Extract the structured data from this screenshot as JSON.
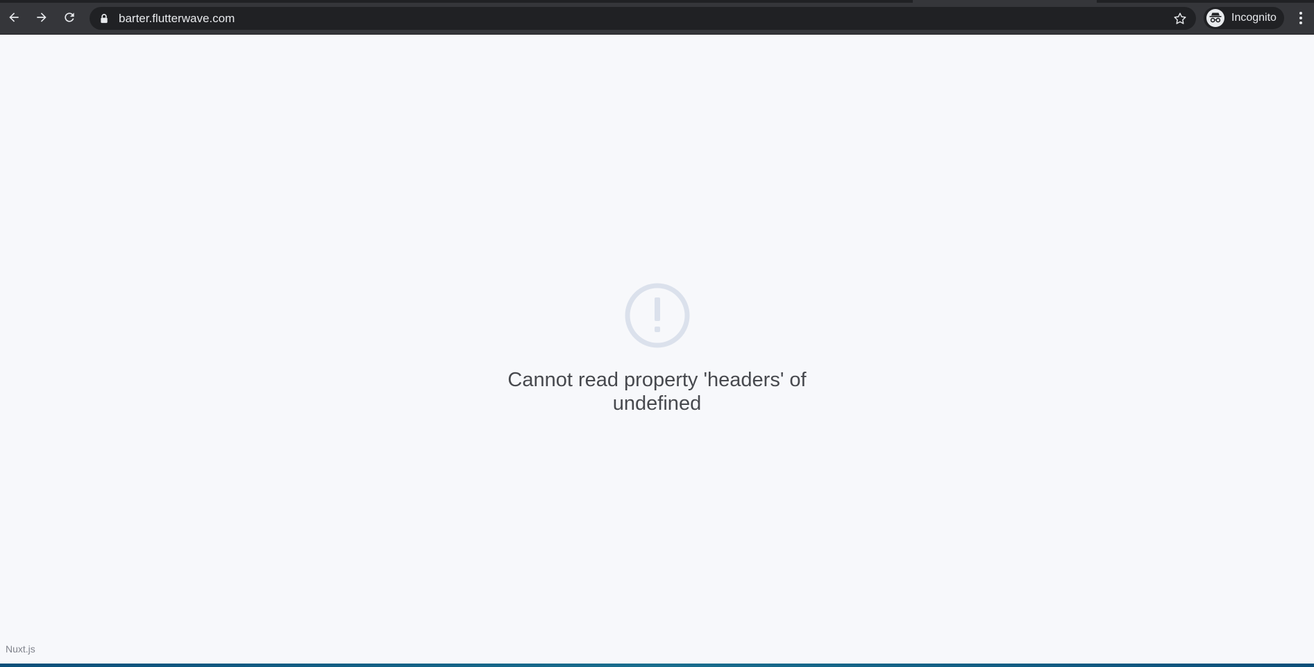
{
  "browser": {
    "url": "barter.flutterwave.com",
    "profile_label": "Incognito",
    "icons": {
      "back": "arrow-left-icon",
      "forward": "arrow-right-icon",
      "reload": "reload-icon",
      "lock": "lock-icon",
      "bookmark": "star-icon",
      "incognito": "incognito-icon",
      "menu": "kebab-menu-icon"
    },
    "colors": {
      "toolbar": "#35363a",
      "omnibox": "#202124",
      "text": "#e8eaed"
    }
  },
  "error_page": {
    "icon": "exclamation-circle-icon",
    "icon_color": "#dbe1ec",
    "message": "Cannot read property 'headers' of undefined",
    "footer_link": "Nuxt.js",
    "background": "#f7f8fb"
  }
}
